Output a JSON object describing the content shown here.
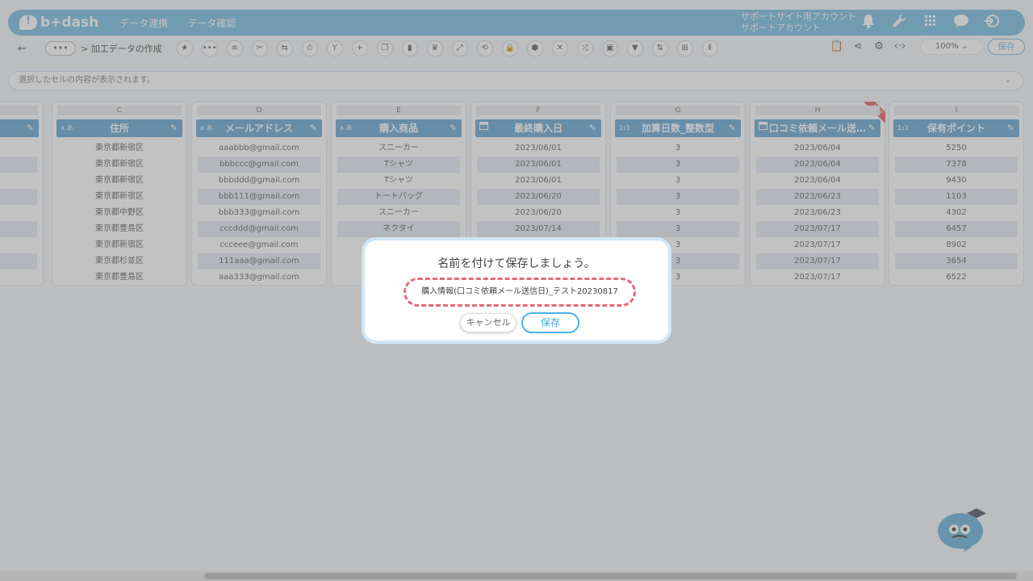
{
  "header": {
    "logo": "b+dash",
    "nav": [
      "データ連携",
      "データ確認"
    ],
    "account_line1": "サポートサイト用アカウント",
    "account_line2": "サポートアカウント",
    "icons": [
      "bell-icon",
      "wrench-icon",
      "apps-grid-icon",
      "help-chat-icon",
      "logout-icon"
    ]
  },
  "toolbar": {
    "dots": "•••",
    "breadcrumb": "> 加工データの作成",
    "zoom": "100%",
    "save_label": "保存"
  },
  "cellbar": {
    "placeholder": "選択したセルの内容が表示されます。"
  },
  "columns": [
    {
      "letter": "C",
      "type": "a あ",
      "name": "住所",
      "cells": [
        "東京都新宿区",
        "東京都新宿区",
        "東京都新宿区",
        "東京都新宿区",
        "東京都中野区",
        "東京都豊島区",
        "東京都新宿区",
        "東京都杉並区",
        "東京都豊島区"
      ]
    },
    {
      "letter": "D",
      "type": "a あ",
      "name": "メールアドレス",
      "cells": [
        "aaabbb@gmail.com",
        "bbbccc@gmail.com",
        "bbbddd@gmail.com",
        "bbb111@gmail.com",
        "bbb333@gmail.com",
        "cccddd@gmail.com",
        "ccceee@gmail.com",
        "111aaa@gmail.com",
        "aaa333@gmail.com"
      ]
    },
    {
      "letter": "E",
      "type": "a あ",
      "name": "購入商品",
      "cells": [
        "スニーカー",
        "Tシャツ",
        "Tシャツ",
        "トートバッグ",
        "スニーカー",
        "ネクタイ",
        "",
        "",
        ""
      ]
    },
    {
      "letter": "F",
      "type": "📅",
      "name": "最終購入日",
      "cells": [
        "2023/06/01",
        "2023/06/01",
        "2023/06/01",
        "2023/06/20",
        "2023/06/20",
        "2023/07/14",
        "",
        "",
        ""
      ]
    },
    {
      "letter": "G",
      "type": "1₂3",
      "name": "加算日数_整数型",
      "cells": [
        "3",
        "3",
        "3",
        "3",
        "3",
        "3",
        "3",
        "3",
        "3"
      ]
    },
    {
      "letter": "H",
      "type": "📅",
      "name": "口コミ依頼メール送…",
      "new": "NEW",
      "cells": [
        "2023/06/04",
        "2023/06/04",
        "2023/06/04",
        "2023/06/23",
        "2023/06/23",
        "2023/07/17",
        "2023/07/17",
        "2023/07/17",
        "2023/07/17"
      ]
    },
    {
      "letter": "I",
      "type": "1₂3",
      "name": "保有ポイント",
      "cells": [
        "5250",
        "7378",
        "9430",
        "1103",
        "4302",
        "6457",
        "8902",
        "3654",
        "6522"
      ]
    }
  ],
  "dialog": {
    "title": "名前を付けて保存しましょう。",
    "filename": "購入情報(口コミ依頼メール送信日)_テスト20230817",
    "cancel": "キャンセル",
    "save": "保存"
  }
}
